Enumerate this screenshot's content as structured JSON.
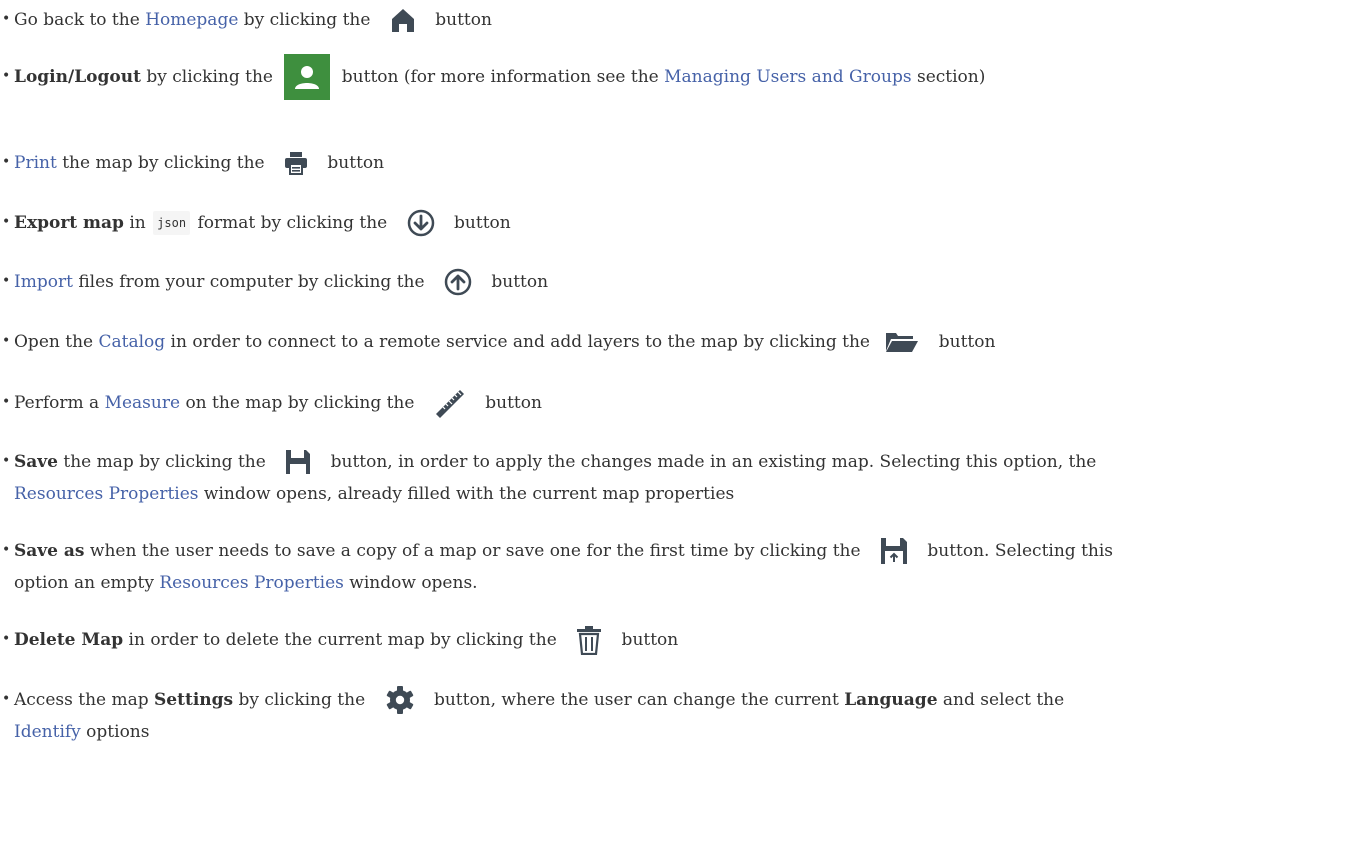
{
  "items": [
    {
      "t0": "Go back to the ",
      "link": "Homepage",
      "t1": " by clicking the ",
      "icon": "home-icon",
      "t2": " button"
    },
    {
      "bold": "Login/Logout",
      "t0": " by clicking the ",
      "icon": "user-icon",
      "t1": " button (for more information see the ",
      "link": "Managing Users and Groups",
      "t2": " section)"
    },
    {
      "link": "Print",
      "t0": " the map by clicking the ",
      "icon": "print-icon",
      "t1": " button"
    },
    {
      "bold": "Export map",
      "t0": " in ",
      "code": "json",
      "t1": " format by clicking the ",
      "icon": "download-circle-icon",
      "t2": " button"
    },
    {
      "link": "Import",
      "t0": " files from your computer by clicking the ",
      "icon": "upload-circle-icon",
      "t1": " button"
    },
    {
      "t0": "Open the ",
      "link": "Catalog",
      "t1": " in order to connect to a remote service and add layers to the map by clicking the ",
      "icon": "folder-open-icon",
      "t2": " button"
    },
    {
      "t0": "Perform a ",
      "link": "Measure",
      "t1": " on the map by clicking the ",
      "icon": "ruler-icon",
      "t2": " button"
    },
    {
      "bold": "Save",
      "t0": " the map by clicking the ",
      "icon": "save-icon",
      "t1": " button, in order to apply the changes made in an existing map. Selecting this option, the",
      "link2": "Resources Properties",
      "t2": " window opens, already filled with the current map properties"
    },
    {
      "bold": "Save as",
      "t0": " when the user needs to save a copy of a map or save one for the first time by clicking the ",
      "icon": "save-as-icon",
      "t1": " button. Selecting this",
      "t2": "option an empty ",
      "link2": "Resources Properties",
      "t3": " window opens."
    },
    {
      "bold": "Delete Map",
      "t0": " in order to delete the current map by clicking the ",
      "icon": "trash-icon",
      "t1": " button"
    },
    {
      "t0": "Access the map ",
      "bold": "Settings",
      "t1": " by clicking the ",
      "icon": "gear-icon",
      "t2": " button, where the user can change the current ",
      "bold2": "Language",
      "t3": " and select the",
      "link2": "Identify",
      "t4": " options"
    }
  ],
  "bullet": "•",
  "colors": {
    "link": "#4662a8",
    "user_button_bg": "#3e8f3e",
    "icon_dark": "#333333",
    "text": "#333333"
  }
}
